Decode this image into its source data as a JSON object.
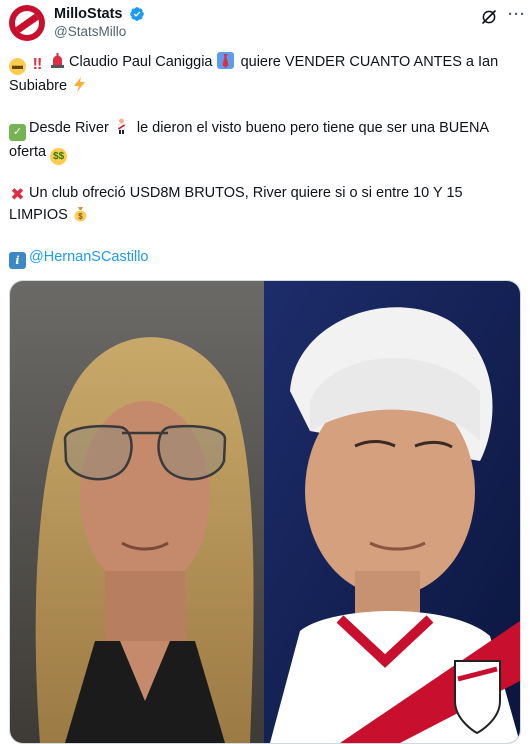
{
  "account": {
    "display_name": "MilloStats",
    "handle": "@StatsMillo",
    "avatar_icon": "river-plate-crest-avatar",
    "verified_icon": "verified-badge-icon"
  },
  "actions": {
    "grok_icon": "grok-icon",
    "more_icon": "more-options-icon",
    "more_label": "···"
  },
  "tweet": {
    "line1_text": "Claudio Paul Caniggia",
    "line1_text2": "quiere VENDER CUANTO ANTES a Ian Subiabre",
    "line2_text": "Desde River",
    "line2_text2": "le dieron el visto bueno pero tiene que ser una BUENA oferta",
    "line3_text": "Un club ofreció USD8M BRUTOS, River quiere si o si entre 10 Y 15 LIMPIOS",
    "mention": "@HernanSCastillo"
  },
  "media": {
    "left_photo": "Claudio Paul Caniggia portrait",
    "right_photo": "Ian Subiabre in River Plate shirt"
  },
  "colors": {
    "accent": "#1d9bf0",
    "river_red": "#c8102e",
    "text": "#0f1419",
    "muted": "#536471"
  }
}
